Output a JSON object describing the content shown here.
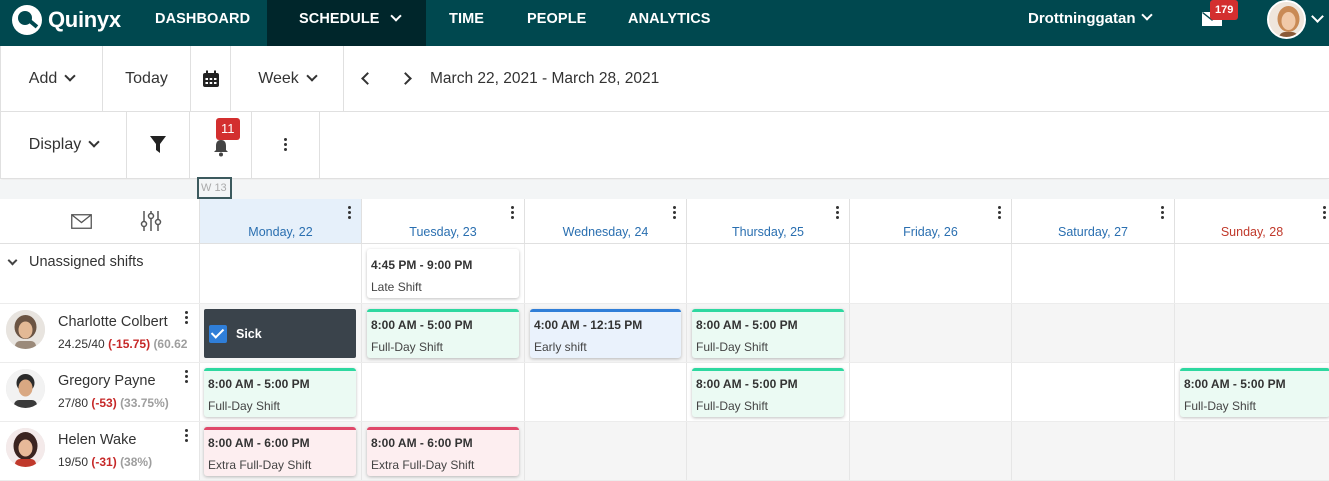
{
  "app": {
    "brand": "Quinyx"
  },
  "nav": {
    "items": [
      {
        "label": "DASHBOARD"
      },
      {
        "label": "SCHEDULE"
      },
      {
        "label": "TIME"
      },
      {
        "label": "PEOPLE"
      },
      {
        "label": "ANALYTICS"
      }
    ],
    "unit": "Drottninggatan",
    "mail_count": "179"
  },
  "toolbar": {
    "add_label": "Add",
    "today_label": "Today",
    "view_label": "Week",
    "date_range": "March 22, 2021 - March 28, 2021",
    "display_label": "Display",
    "notification_count": "11"
  },
  "week_tag": "W 13",
  "days": [
    {
      "label": "Monday, 22"
    },
    {
      "label": "Tuesday, 23"
    },
    {
      "label": "Wednesday, 24"
    },
    {
      "label": "Thursday, 25"
    },
    {
      "label": "Friday, 26"
    },
    {
      "label": "Saturday, 27"
    },
    {
      "label": "Sunday, 28"
    }
  ],
  "unassigned": {
    "label": "Unassigned shifts",
    "shifts": [
      {
        "time": "4:45 PM - 9:00 PM",
        "name": "Late Shift"
      }
    ]
  },
  "employees": [
    {
      "name": "Charlotte Colbert",
      "hours": "24.25/40",
      "diff": "(-15.75)",
      "pct": "(60.62",
      "sick_label": "Sick",
      "shifts": [
        {
          "time": "8:00 AM - 5:00 PM",
          "name": "Full-Day Shift"
        },
        {
          "time": "4:00 AM - 12:15 PM",
          "name": "Early shift"
        },
        {
          "time": "8:00 AM - 5:00 PM",
          "name": "Full-Day Shift"
        }
      ]
    },
    {
      "name": "Gregory Payne",
      "hours": "27/80",
      "diff": "(-53)",
      "pct": "(33.75%)",
      "shifts": [
        {
          "time": "8:00 AM - 5:00 PM",
          "name": "Full-Day Shift"
        },
        {
          "time": "8:00 AM - 5:00 PM",
          "name": "Full-Day Shift"
        },
        {
          "time": "8:00 AM - 5:00 PM",
          "name": "Full-Day Shift"
        }
      ]
    },
    {
      "name": "Helen Wake",
      "hours": "19/50",
      "diff": "(-31)",
      "pct": "(38%)",
      "shifts": [
        {
          "time": "8:00 AM - 6:00 PM",
          "name": "Extra Full-Day Shift"
        },
        {
          "time": "8:00 AM - 6:00 PM",
          "name": "Extra Full-Day Shift"
        }
      ]
    }
  ],
  "colors": {
    "nav_bg": "#00484f",
    "nav_active": "#00262b",
    "badge": "#d32f2f",
    "shift_green": "#2ed8a0",
    "shift_blue": "#2f7ed8",
    "shift_red": "#e0486a",
    "sick_bg": "#3a434b"
  }
}
